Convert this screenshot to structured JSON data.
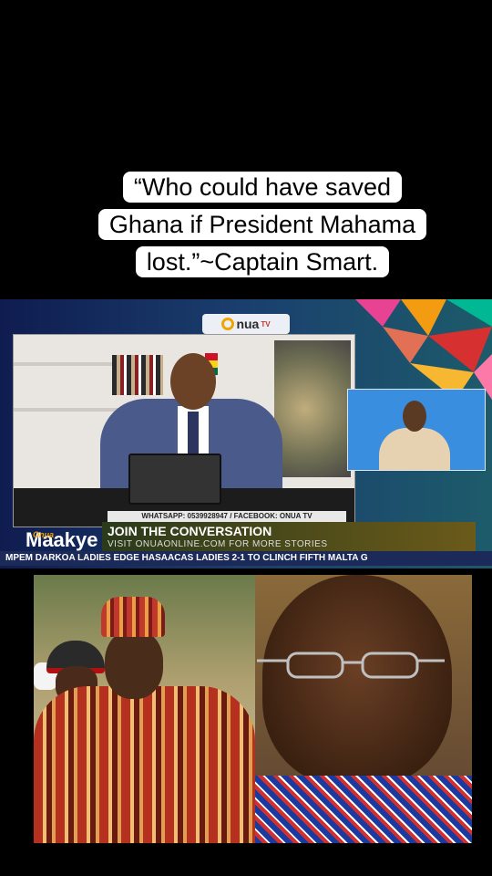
{
  "caption": {
    "line1": "“Who could have saved",
    "line2": "Ghana if President Mahama",
    "line3": "lost.”~Captain Smart."
  },
  "broadcast": {
    "channel_logo": "nua",
    "channel_logo_suffix": "TV",
    "contact_bar": "WHATSAPP: 0539928947 / FACEBOOK: ONUA TV",
    "show_brand": "Onua",
    "show_name": "Maakye",
    "join_title": "JOIN THE CONVERSATION",
    "join_subtitle": "VISIT ONUAONLINE.COM FOR MORE STORIES",
    "ticker": "MPEM DARKOA LADIES EDGE HASAACAS LADIES 2-1 TO CLINCH FIFTH MALTA G"
  },
  "colors": {
    "caption_bg": "#ffffff",
    "broadcast_bg": "#0f1c50",
    "ticker_bg": "#1c2a5a",
    "accent": "#f0a500"
  }
}
